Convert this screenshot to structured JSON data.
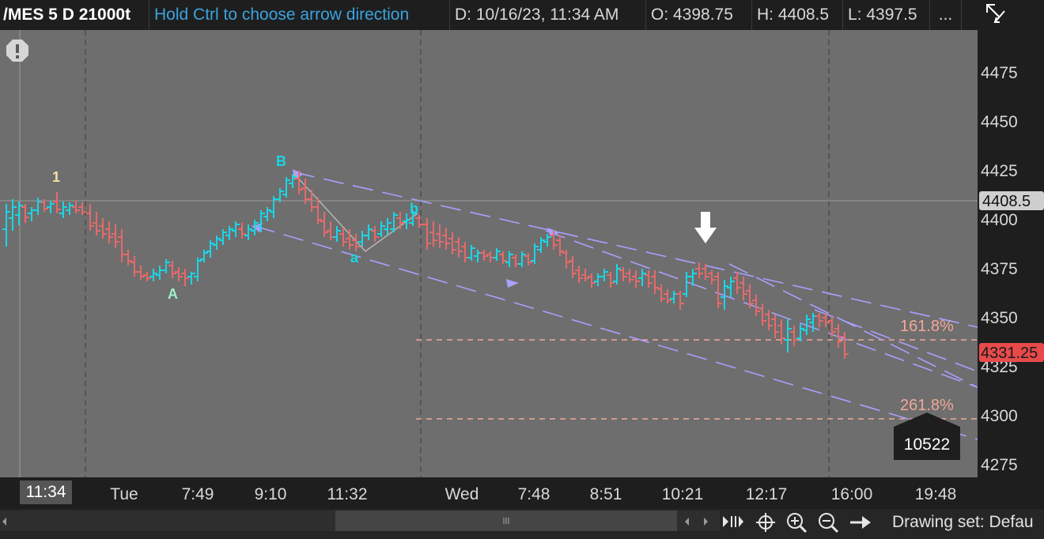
{
  "header": {
    "symbol": "/MES 5 D 21000t",
    "hint": "Hold Ctrl to choose arrow direction",
    "date": "D: 10/16/23, 11:34 AM",
    "open": "O: 4398.75",
    "high": "H: 4408.5",
    "low": "L: 4397.5",
    "more": "..."
  },
  "price_axis": {
    "ticks": [
      "4475",
      "4450",
      "4425",
      "4400",
      "4375",
      "4350",
      "4325",
      "4300",
      "4275"
    ],
    "crosshair_price": "4408.5",
    "last_price": "4331.25",
    "last_price_color": "#e84a4a"
  },
  "time_axis": {
    "crosshair_time": "11:34",
    "labels": [
      "Tue",
      "7:49",
      "9:10",
      "11:32",
      "Wed",
      "7:48",
      "8:51",
      "10:21",
      "12:17",
      "16:00",
      "19:48"
    ]
  },
  "wave_labels": {
    "w1": "1",
    "wA": "A",
    "wB": "B",
    "wa": "a",
    "wb": "b"
  },
  "fib": {
    "level1": "161.8%",
    "level2": "261.8%"
  },
  "volume_badge": "10522",
  "footer": {
    "drawing_set": "Drawing set: Defau"
  },
  "colors": {
    "chart_bg": "#6e6e6e",
    "up_bar": "#19d6e6",
    "down_bar": "#e56a6a",
    "channel": "#a9a0ff",
    "fib_line": "#f0a898"
  },
  "icons": [
    "alert-icon",
    "arrow-direction-icon",
    "scroll-left-icon",
    "scroll-right-icon",
    "scroll-handle-icon",
    "play-icon",
    "crosshair-icon",
    "zoom-in-icon",
    "zoom-out-icon",
    "arrow-right-icon"
  ]
}
